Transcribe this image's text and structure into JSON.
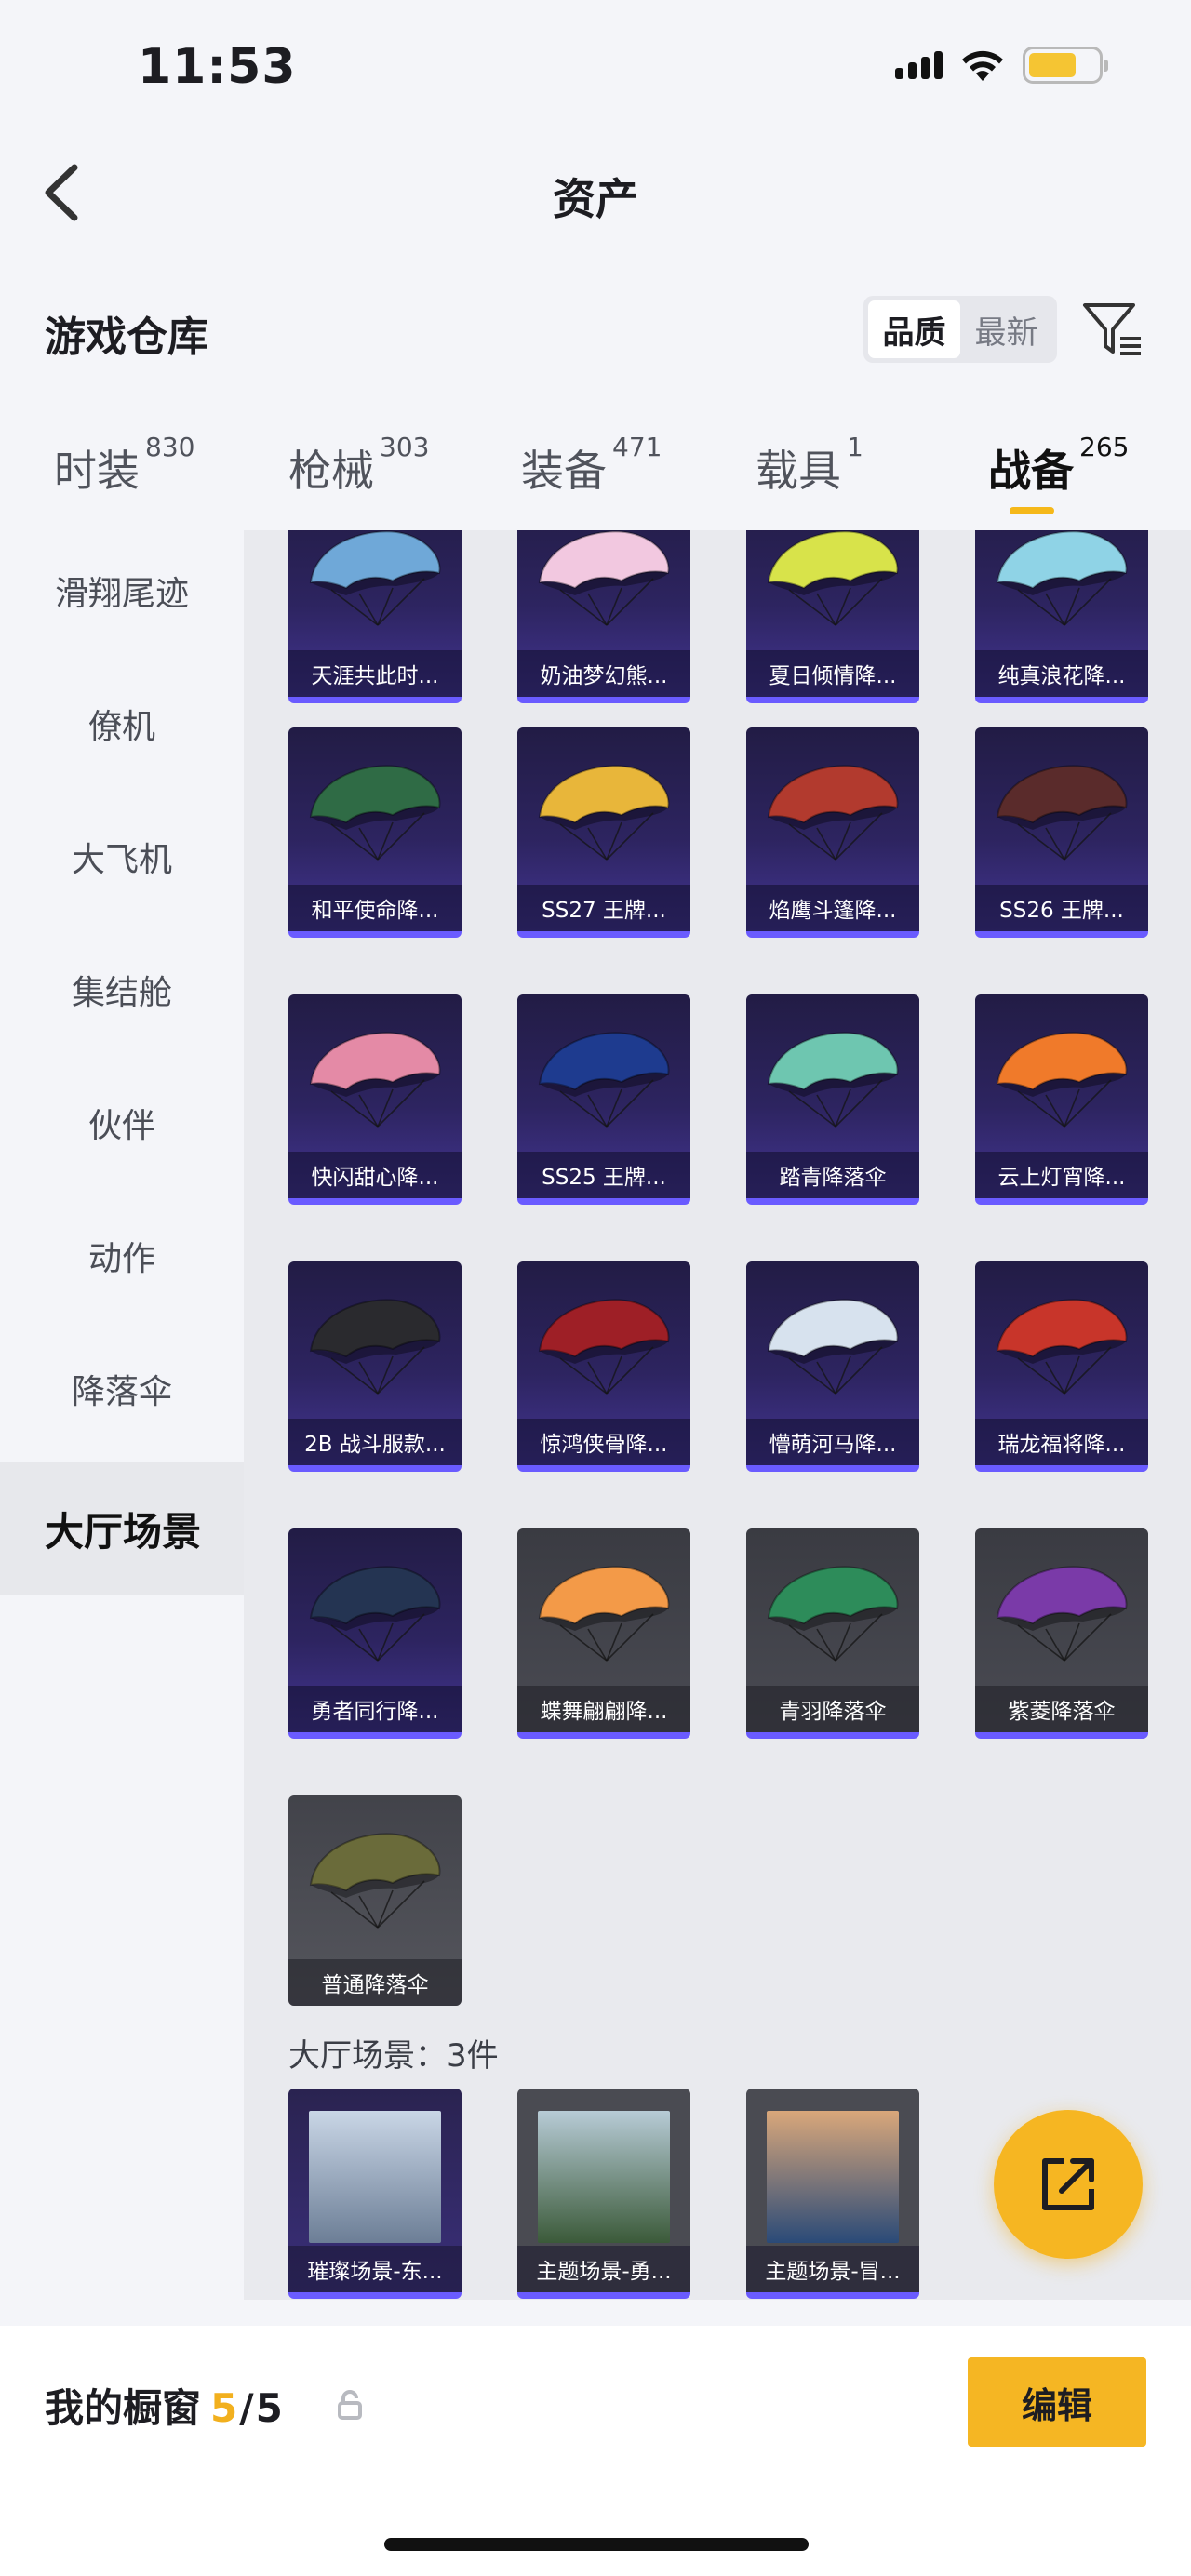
{
  "status_bar": {
    "time": "11:53"
  },
  "header": {
    "title": "资产",
    "back_icon": "chevron-left-icon"
  },
  "section": {
    "title": "游戏仓库",
    "sort_options": [
      "品质",
      "最新"
    ],
    "sort_selected": "品质",
    "filter_icon": "filter-icon"
  },
  "tabs": [
    {
      "label": "时装",
      "count": "830"
    },
    {
      "label": "枪械",
      "count": "303"
    },
    {
      "label": "装备",
      "count": "471"
    },
    {
      "label": "载具",
      "count": "1"
    },
    {
      "label": "战备",
      "count": "265",
      "active": true
    }
  ],
  "sidebar": {
    "items": [
      "滑翔尾迹",
      "僚机",
      "大飞机",
      "集结舱",
      "伙伴",
      "动作",
      "降落伞",
      "大厅场景"
    ],
    "active": "大厅场景"
  },
  "parachutes": [
    {
      "name": "天涯共此时...",
      "color": "#6fa8d8"
    },
    {
      "name": "奶油梦幻熊...",
      "color": "#f2c8e0"
    },
    {
      "name": "夏日倾情降...",
      "color": "#d8e34a"
    },
    {
      "name": "纯真浪花降...",
      "color": "#8fd3e6"
    },
    {
      "name": "和平使命降...",
      "color": "#2f6b45"
    },
    {
      "name": "SS27 王牌...",
      "color": "#e8b63a"
    },
    {
      "name": "焰鹰斗篷降...",
      "color": "#b23a2e"
    },
    {
      "name": "SS26 王牌...",
      "color": "#5a2b2b"
    },
    {
      "name": "快闪甜心降...",
      "color": "#e48aa6"
    },
    {
      "name": "SS25 王牌...",
      "color": "#1e3b8f"
    },
    {
      "name": "踏青降落伞",
      "color": "#6ec6b0"
    },
    {
      "name": "云上灯宵降...",
      "color": "#f07a2a"
    },
    {
      "name": "2B 战斗服款...",
      "color": "#2a2a2e"
    },
    {
      "name": "惊鸿侠骨降...",
      "color": "#9e1f26"
    },
    {
      "name": "懵萌河马降...",
      "color": "#d7e2ee"
    },
    {
      "name": "瑞龙福将降...",
      "color": "#c8352a"
    },
    {
      "name": "勇者同行降...",
      "color": "#243452"
    },
    {
      "name": "蝶舞翩翩降...",
      "color": "#f39a48",
      "grey": true
    },
    {
      "name": "青羽降落伞",
      "color": "#2d8c5a",
      "grey": true
    },
    {
      "name": "紫菱降落伞",
      "color": "#7a3aa8",
      "grey": true
    },
    {
      "name": "普通降落伞",
      "color": "#6a6b3a",
      "plain": true
    }
  ],
  "lobby_scene": {
    "count_label": "大厅场景：3件",
    "items": [
      {
        "name": "璀璨场景-东...",
        "color_top": "#c9d6e6",
        "color_bottom": "#6c7e96"
      },
      {
        "name": "主题场景-勇...",
        "color_top": "#b7cbd6",
        "color_bottom": "#3b5a39",
        "grey": true
      },
      {
        "name": "主题场景-冒...",
        "color_top": "#d9a77a",
        "color_bottom": "#2a4a78",
        "grey": true
      }
    ]
  },
  "share_button_icon": "share-icon",
  "bottom": {
    "label": "我的橱窗",
    "current": "5",
    "slash": "/",
    "total": "5",
    "lock_icon": "lock-icon",
    "edit_label": "编辑"
  }
}
